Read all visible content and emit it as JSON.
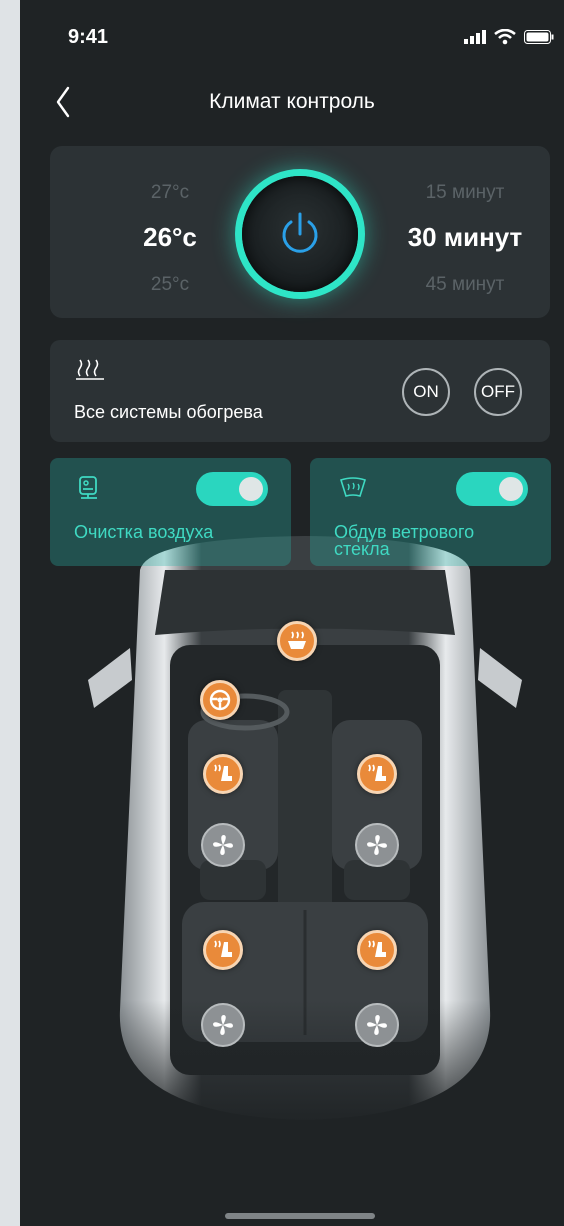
{
  "status": {
    "time": "9:41"
  },
  "header": {
    "title": "Климат контроль"
  },
  "temperature": {
    "options": [
      "27°c",
      "26°c",
      "25°c"
    ],
    "selected": "26°c"
  },
  "timer": {
    "options": [
      "15 минут",
      "30 минут",
      "45 минут"
    ],
    "selected": "30 минут"
  },
  "heating": {
    "label": "Все системы обогрева",
    "on_label": "ON",
    "off_label": "OFF"
  },
  "cards": [
    {
      "label": "Очистка воздуха",
      "enabled": true
    },
    {
      "label": "Обдув ветрового стекла",
      "enabled": true
    }
  ],
  "colors": {
    "accent": "#2ee5c7",
    "heat": "#e98a3a",
    "background": "#1f2325",
    "panel": "#2c3235"
  }
}
